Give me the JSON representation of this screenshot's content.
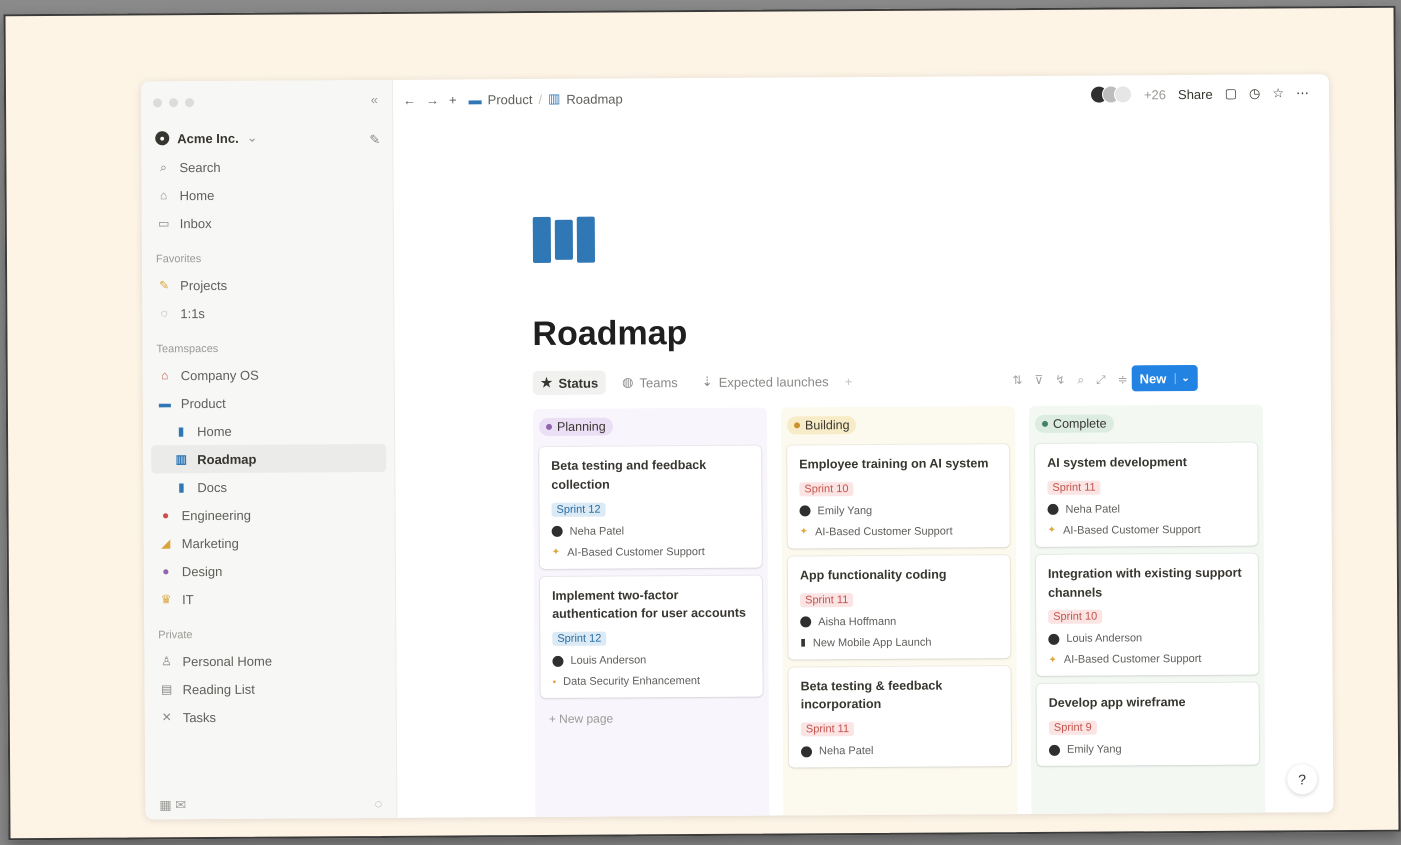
{
  "window": {
    "collapse_icon": "«"
  },
  "sidebar": {
    "workspace": "Acme Inc.",
    "top_items": [
      {
        "label": "Search",
        "icon": "search-icon"
      },
      {
        "label": "Home",
        "icon": "home-icon"
      },
      {
        "label": "Inbox",
        "icon": "inbox-icon"
      }
    ],
    "favorites_label": "Favorites",
    "favorites": [
      {
        "label": "Projects"
      },
      {
        "label": "1:1s"
      }
    ],
    "teamspaces_label": "Teamspaces",
    "teamspaces": [
      {
        "label": "Company OS"
      },
      {
        "label": "Product"
      },
      {
        "label": "Home"
      },
      {
        "label": "Roadmap"
      },
      {
        "label": "Docs"
      },
      {
        "label": "Engineering"
      },
      {
        "label": "Marketing"
      },
      {
        "label": "Design"
      },
      {
        "label": "IT"
      }
    ],
    "private_label": "Private",
    "private": [
      {
        "label": "Personal Home"
      },
      {
        "label": "Reading List"
      },
      {
        "label": "Tasks"
      }
    ]
  },
  "topbar": {
    "breadcrumb": [
      "Product",
      "Roadmap"
    ],
    "plus_count": "+26",
    "share_label": "Share"
  },
  "page": {
    "title": "Roadmap"
  },
  "views": {
    "tabs": [
      "Status",
      "Teams",
      "Expected launches"
    ],
    "add": "+",
    "new_label": "New"
  },
  "board": {
    "columns": [
      {
        "name": "Planning",
        "cards": [
          {
            "title": "Beta testing and feedback collection",
            "sprint": "Sprint 12",
            "person": "Neha Patel",
            "project": "AI-Based Customer Support"
          },
          {
            "title": "Implement two-factor authentication for user accounts",
            "sprint": "Sprint 12",
            "person": "Louis Anderson",
            "project": "Data Security Enhancement"
          }
        ],
        "new_page": "+ New page"
      },
      {
        "name": "Building",
        "cards": [
          {
            "title": "Employee training on AI system",
            "sprint": "Sprint 10",
            "person": "Emily Yang",
            "project": "AI-Based Customer Support"
          },
          {
            "title": "App functionality coding",
            "sprint": "Sprint 11",
            "person": "Aisha Hoffmann",
            "project": "New Mobile App Launch"
          },
          {
            "title": "Beta testing & feedback incorporation",
            "sprint": "Sprint 11",
            "person": "Neha Patel",
            "project": ""
          }
        ]
      },
      {
        "name": "Complete",
        "cards": [
          {
            "title": "AI system development",
            "sprint": "Sprint 11",
            "person": "Neha Patel",
            "project": "AI-Based Customer Support"
          },
          {
            "title": "Integration with existing support channels",
            "sprint": "Sprint 10",
            "person": "Louis Anderson",
            "project": "AI-Based Customer Support"
          },
          {
            "title": "Develop app wireframe",
            "sprint": "Sprint 9",
            "person": "Emily Yang",
            "project": ""
          }
        ]
      }
    ]
  },
  "help_icon": "?"
}
